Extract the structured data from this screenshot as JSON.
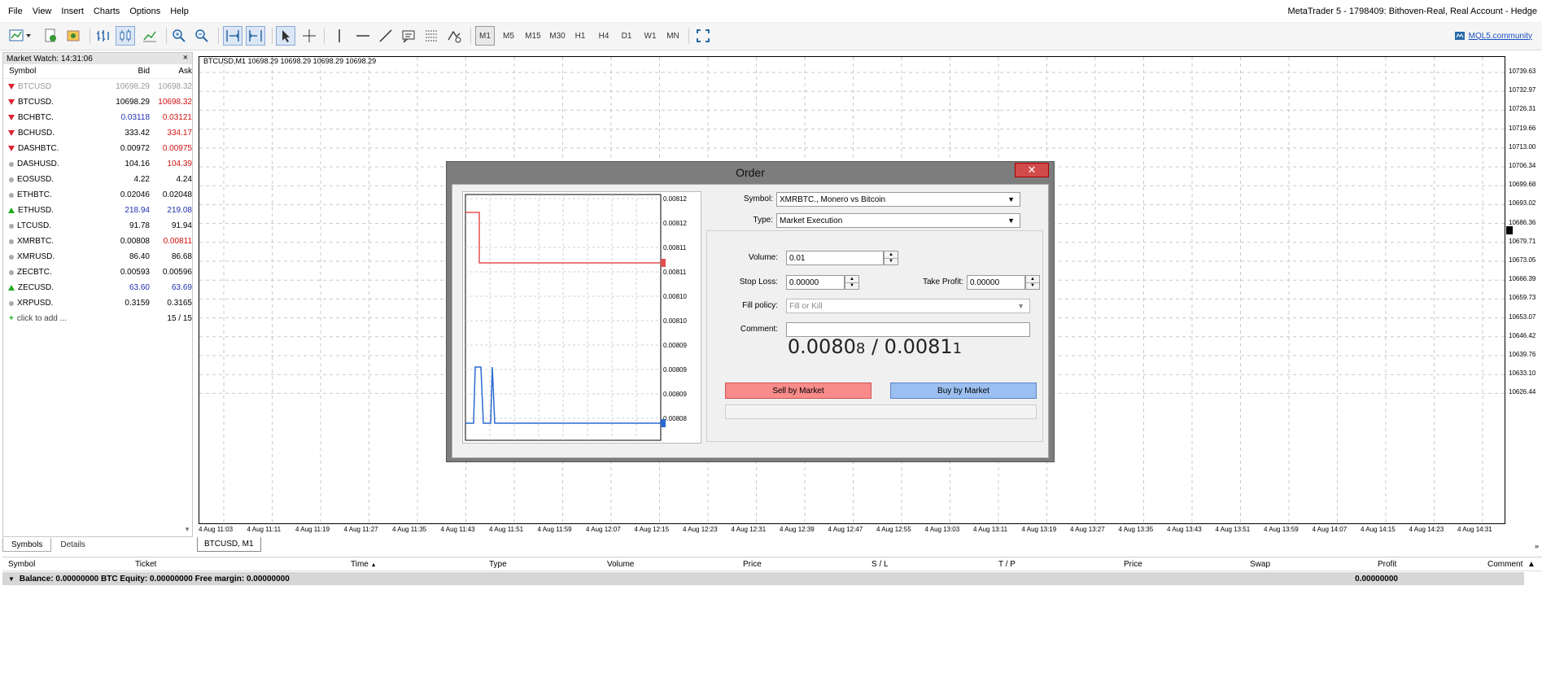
{
  "menu": [
    "File",
    "View",
    "Insert",
    "Charts",
    "Options",
    "Help"
  ],
  "app_title": "MetaTrader 5 - 1798409: Bithoven-Real, Real Account - Hedge",
  "toolbar": {
    "timeframes": [
      "M1",
      "M5",
      "M15",
      "M30",
      "H1",
      "H4",
      "D1",
      "W1",
      "MN"
    ],
    "active_timeframe": "M1",
    "mql5_label": "MQL5.community"
  },
  "market_watch": {
    "title": "Market Watch: 14:31:06",
    "col_symbol": "Symbol",
    "col_bid": "Bid",
    "col_ask": "Ask",
    "rows": [
      {
        "symbol": "BTCUSD",
        "bid": "10698.29",
        "ask": "10698.32",
        "icon": "down-arrow",
        "bid_color": "gray",
        "ask_color": "gray",
        "sym_color": "gray"
      },
      {
        "symbol": "BTCUSD.",
        "bid": "10698.29",
        "ask": "10698.32",
        "icon": "down-arrow",
        "bid_color": "black",
        "ask_color": "red",
        "sym_color": "black"
      },
      {
        "symbol": "BCHBTC.",
        "bid": "0.03118",
        "ask": "0.03121",
        "icon": "down-arrow",
        "bid_color": "blue",
        "ask_color": "red",
        "sym_color": "black"
      },
      {
        "symbol": "BCHUSD.",
        "bid": "333.42",
        "ask": "334.17",
        "icon": "down-arrow",
        "bid_color": "black",
        "ask_color": "red",
        "sym_color": "black"
      },
      {
        "symbol": "DASHBTC.",
        "bid": "0.00972",
        "ask": "0.00975",
        "icon": "down-arrow",
        "bid_color": "black",
        "ask_color": "red",
        "sym_color": "black"
      },
      {
        "symbol": "DASHUSD.",
        "bid": "104.16",
        "ask": "104.39",
        "icon": "dot",
        "bid_color": "black",
        "ask_color": "red",
        "sym_color": "black"
      },
      {
        "symbol": "EOSUSD.",
        "bid": "4.22",
        "ask": "4.24",
        "icon": "dot",
        "bid_color": "black",
        "ask_color": "black",
        "sym_color": "black"
      },
      {
        "symbol": "ETHBTC.",
        "bid": "0.02046",
        "ask": "0.02048",
        "icon": "dot",
        "bid_color": "black",
        "ask_color": "black",
        "sym_color": "black"
      },
      {
        "symbol": "ETHUSD.",
        "bid": "218.94",
        "ask": "219.08",
        "icon": "up-arrow",
        "bid_color": "blue",
        "ask_color": "blue",
        "sym_color": "black"
      },
      {
        "symbol": "LTCUSD.",
        "bid": "91.78",
        "ask": "91.94",
        "icon": "dot",
        "bid_color": "black",
        "ask_color": "black",
        "sym_color": "black"
      },
      {
        "symbol": "XMRBTC.",
        "bid": "0.00808",
        "ask": "0.00811",
        "icon": "dot",
        "bid_color": "black",
        "ask_color": "red",
        "sym_color": "black"
      },
      {
        "symbol": "XMRUSD.",
        "bid": "86.40",
        "ask": "86.68",
        "icon": "dot",
        "bid_color": "black",
        "ask_color": "black",
        "sym_color": "black"
      },
      {
        "symbol": "ZECBTC.",
        "bid": "0.00593",
        "ask": "0.00596",
        "icon": "dot",
        "bid_color": "black",
        "ask_color": "black",
        "sym_color": "black"
      },
      {
        "symbol": "ZECUSD.",
        "bid": "63.60",
        "ask": "63.69",
        "icon": "up-arrow",
        "bid_color": "blue",
        "ask_color": "blue",
        "sym_color": "black"
      },
      {
        "symbol": "XRPUSD.",
        "bid": "0.3159",
        "ask": "0.3165",
        "icon": "dot",
        "bid_color": "black",
        "ask_color": "black",
        "sym_color": "black"
      }
    ],
    "add_label": "click to add ...",
    "count": "15 / 15"
  },
  "panel_tabs": [
    "Symbols",
    "Details"
  ],
  "chart": {
    "info": "BTCUSD,M1  10698.29 10698.29 10698.29 10698.29",
    "tab_label": "BTCUSD, M1",
    "y_labels": [
      "10739.63",
      "10732.97",
      "10726.31",
      "10719.66",
      "10713.00",
      "10706.34",
      "10699.68",
      "10693.02",
      "10686.36",
      "10679.71",
      "10673.05",
      "10666.39",
      "10659.73",
      "10653.07",
      "10646.42",
      "10639.76",
      "10633.10",
      "10626.44"
    ],
    "x_labels": [
      "4 Aug 11:03",
      "4 Aug 11:11",
      "4 Aug 11:19",
      "4 Aug 11:27",
      "4 Aug 11:35",
      "4 Aug 11:43",
      "4 Aug 11:51",
      "4 Aug 11:59",
      "4 Aug 12:07",
      "4 Aug 12:15",
      "4 Aug 12:23",
      "4 Aug 12:31",
      "4 Aug 12:39",
      "4 Aug 12:47",
      "4 Aug 12:55",
      "4 Aug 13:03",
      "4 Aug 13:11",
      "4 Aug 13:19",
      "4 Aug 13:27",
      "4 Aug 13:35",
      "4 Aug 13:43",
      "4 Aug 13:51",
      "4 Aug 13:59",
      "4 Aug 14:07",
      "4 Aug 14:15",
      "4 Aug 14:23",
      "4 Aug 14:31"
    ]
  },
  "toolbox": {
    "columns": [
      "Symbol",
      "Ticket",
      "Time",
      "Type",
      "Volume",
      "Price",
      "S / L",
      "T / P",
      "Price",
      "Swap",
      "Profit",
      "Comment"
    ],
    "balance_text": "Balance: 0.00000000 BTC  Equity: 0.00000000  Free margin: 0.00000000",
    "profit": "0.00000000"
  },
  "order": {
    "title": "Order",
    "close": "✕",
    "symbol_label": "Symbol:",
    "symbol_value": "XMRBTC., Monero vs Bitcoin",
    "type_label": "Type:",
    "type_value": "Market Execution",
    "volume_label": "Volume:",
    "volume_value": "0.01",
    "sl_label": "Stop Loss:",
    "sl_value": "0.00000",
    "tp_label": "Take Profit:",
    "tp_value": "0.00000",
    "fill_label": "Fill policy:",
    "fill_value": "Fill or Kill",
    "comment_label": "Comment:",
    "comment_value": "",
    "bid_main": "0.0080",
    "bid_small": "8",
    "sep": " / ",
    "ask_main": "0.0081",
    "ask_small": "1",
    "sell_label": "Sell by Market",
    "buy_label": "Buy by Market",
    "mini_y_labels": [
      "0.00812",
      "0.00812",
      "0.00811",
      "0.00811",
      "0.00810",
      "0.00810",
      "0.00809",
      "0.00809",
      "0.00809",
      "0.00808"
    ]
  },
  "colors": {
    "red": "#d01010",
    "blue": "#1f2fb0",
    "gray": "#999999",
    "sell": "#f98b8b",
    "buy": "#9bbff0"
  }
}
